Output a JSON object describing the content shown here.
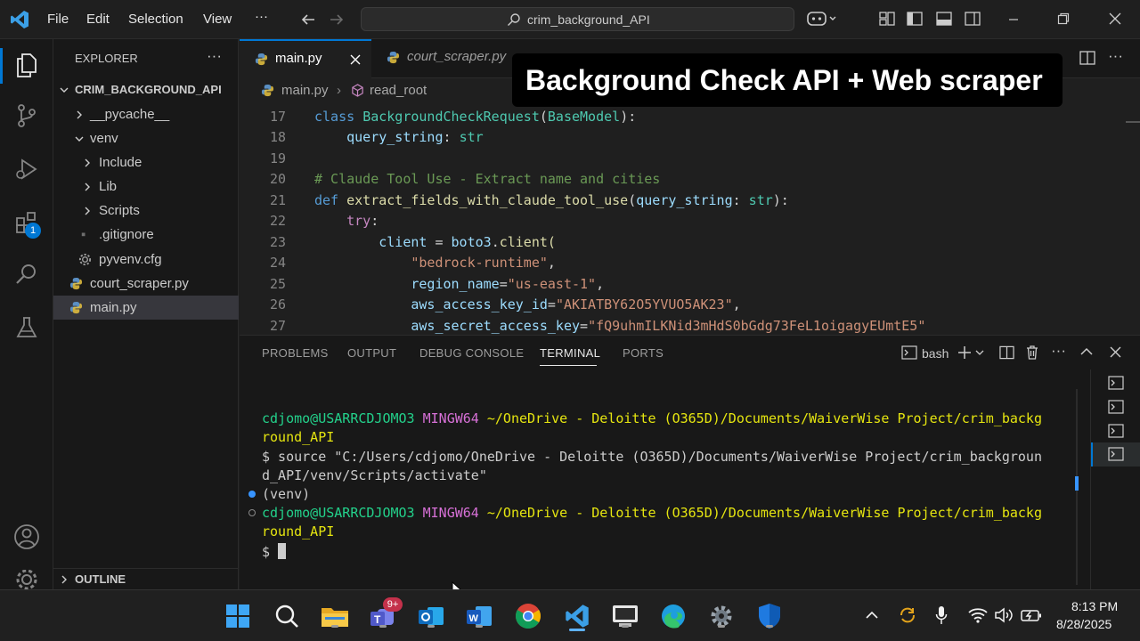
{
  "titlebar": {
    "menus": [
      "File",
      "Edit",
      "Selection",
      "View",
      "···"
    ],
    "search_text": "crim_background_API"
  },
  "sidebar": {
    "title": "EXPLORER",
    "more": "···",
    "root": "CRIM_BACKGROUND_API",
    "items": [
      "__pycache__",
      "venv",
      "Include",
      "Lib",
      "Scripts",
      ".gitignore",
      "pyvenv.cfg",
      "court_scraper.py",
      "main.py"
    ],
    "outline": "OUTLINE"
  },
  "activity": {
    "badge": "1"
  },
  "editor": {
    "tabs": [
      "main.py",
      "court_scraper.py"
    ],
    "breadcrumb": [
      "main.py",
      "read_root"
    ],
    "line_numbers": [
      "17",
      "18",
      "19",
      "20",
      "21",
      "22",
      "23",
      "24",
      "25",
      "26",
      "27"
    ],
    "tokens": {
      "l17": [
        "class",
        "BackgroundCheckRequest",
        "(",
        "BaseModel",
        "):"
      ],
      "l18": [
        "query_string",
        ": ",
        "str"
      ],
      "l20": "# Claude Tool Use - Extract name and cities",
      "l21": [
        "def",
        "extract_fields_with_claude_tool_use",
        "(",
        "query_string",
        ": ",
        "str",
        "):"
      ],
      "l22": [
        "try",
        ":"
      ],
      "l23": [
        "client",
        " = ",
        "boto3",
        ".",
        "client",
        "("
      ],
      "l24": [
        "\"bedrock-runtime\"",
        ","
      ],
      "l25": [
        "region_name",
        "=",
        "\"us-east-1\"",
        ","
      ],
      "l26": [
        "aws_access_key_id",
        "=",
        "\"AKIATBY62O5YVUO5AK23\"",
        ","
      ],
      "l27": [
        "aws_secret_access_key",
        "=",
        "\"fQ9uhmILKNid3mHdS0bGdg73FeL1oigagyEUmtE5\""
      ]
    }
  },
  "overlay": {
    "text": "Background Check API + Web scraper"
  },
  "panel": {
    "tabs": [
      "PROBLEMS",
      "OUTPUT",
      "DEBUG CONSOLE",
      "TERMINAL",
      "PORTS"
    ],
    "shell": "bash",
    "terminal": {
      "user1": "cdjomo@USARRCDJOMO3",
      "env1": "MINGW64",
      "path1a": "~/OneDrive - Deloitte (O365D)/Documents/WaiverWise Project/crim_backg",
      "path1b": "round_API",
      "cmd_a": "$ source \"C:/Users/cdjomo/OneDrive - Deloitte (O365D)/Documents/WaiverWise Project/crim_backgroun",
      "cmd_b": "d_API/venv/Scripts/activate\"",
      "venv": "(venv)",
      "user2": "cdjomo@USARRCDJOMO3",
      "env2": "MINGW64",
      "path2a": "~/OneDrive - Deloitte (O365D)/Documents/WaiverWise Project/crim_backg",
      "path2b": "round_API",
      "prompt": "$"
    }
  },
  "taskbar": {
    "teams_badge": "9+",
    "time": "8:13 PM",
    "date": "8/28/2025"
  }
}
